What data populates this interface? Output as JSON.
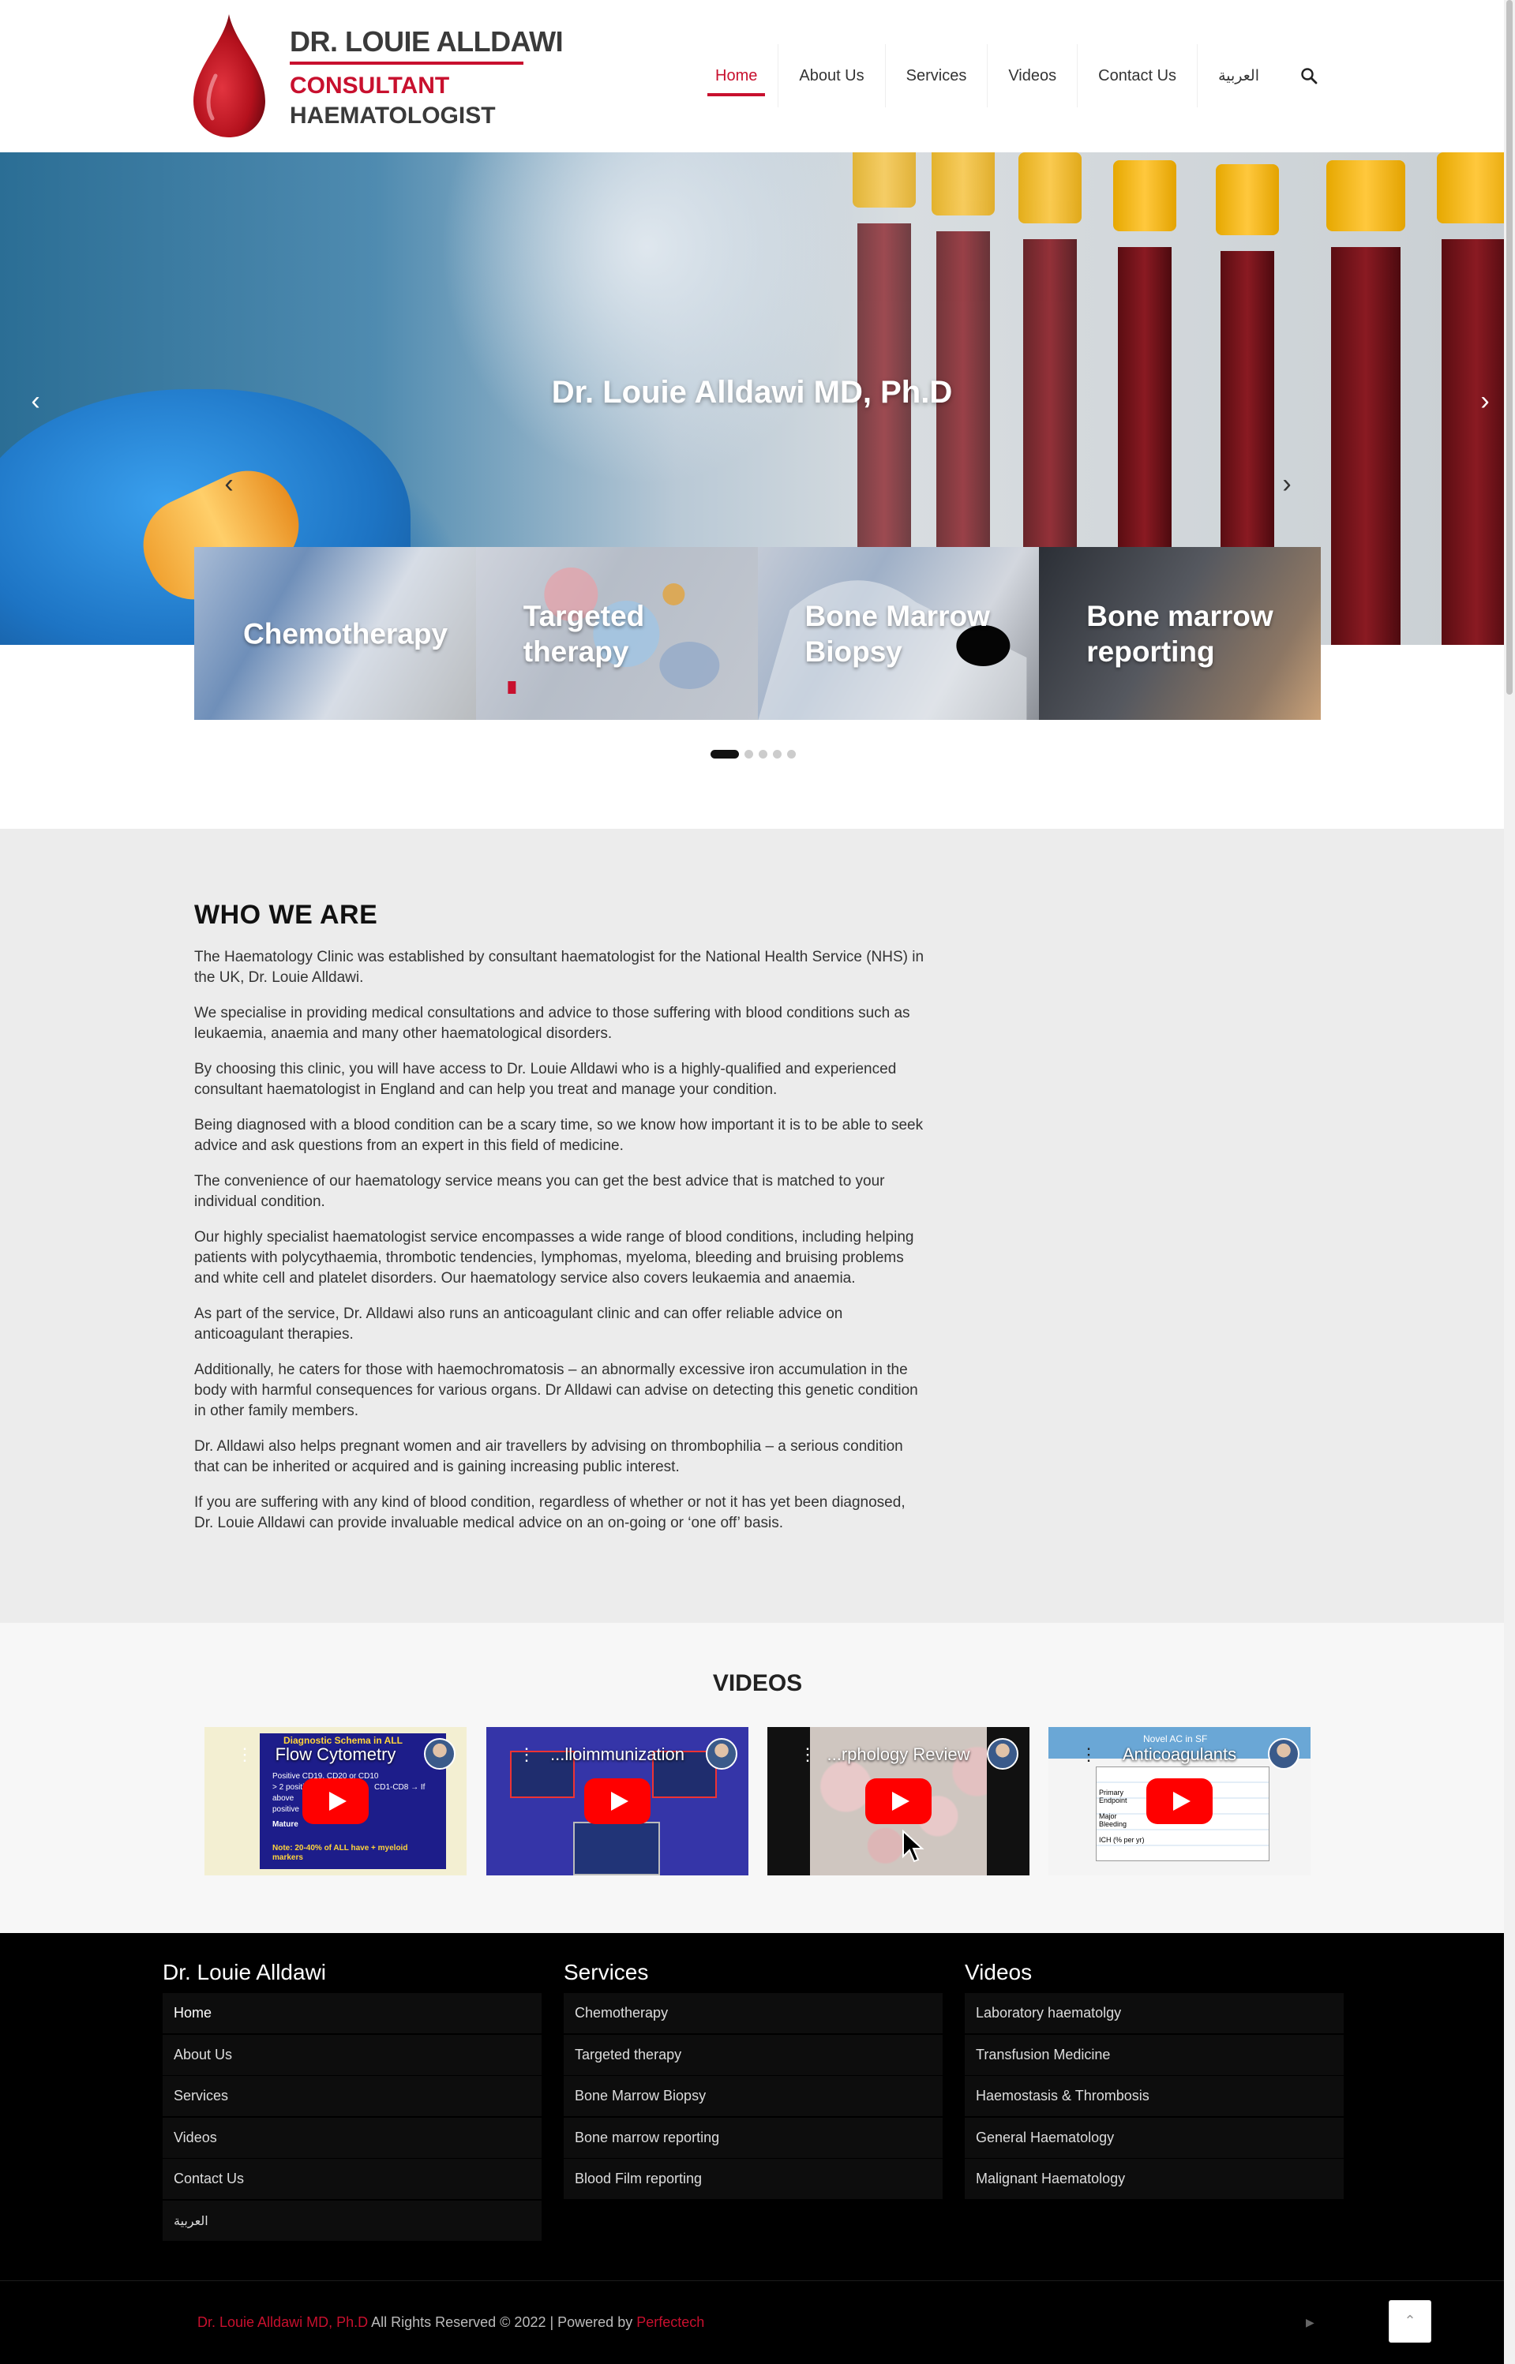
{
  "logo": {
    "name": "DR. LOUIE ALLDAWI",
    "line1": "CONSULTANT",
    "line2": "HAEMATOLOGIST"
  },
  "nav": {
    "items": [
      {
        "label": "Home",
        "active": true
      },
      {
        "label": "About Us"
      },
      {
        "label": "Services"
      },
      {
        "label": "Videos"
      },
      {
        "label": "Contact Us"
      },
      {
        "label": "العربية"
      }
    ],
    "search_icon": "search-icon"
  },
  "hero": {
    "title": "Dr. Louie Alldawi MD, Ph.D",
    "prev_icon": "chevron-left-icon",
    "next_icon": "chevron-right-icon"
  },
  "services_cards": [
    {
      "label": "Chemotherapy"
    },
    {
      "label": "Targeted therapy"
    },
    {
      "label": "Bone Marrow Biopsy"
    },
    {
      "label": "Bone marrow reporting"
    }
  ],
  "carousel_dots": {
    "count": 5,
    "active": 0
  },
  "who": {
    "title": "WHO WE ARE",
    "paragraphs": [
      "The Haematology Clinic was established by consultant haematologist for the National Health Service (NHS) in the UK, Dr. Louie Alldawi.",
      "We specialise in providing medical consultations and advice to those suffering with blood conditions such as leukaemia, anaemia and many other haematological disorders.",
      "By choosing this clinic, you will have access to Dr. Louie Alldawi who is a highly-qualified and experienced consultant haematologist in England and can help you treat and manage your condition.",
      "Being diagnosed with a blood condition can be a scary time, so we know how important it is to be able to seek advice and ask questions from an expert in this field of medicine.",
      "The convenience of our haematology service means you can get the best advice that is matched to your individual condition.",
      "Our highly specialist haematologist service encompasses a wide range of blood conditions, including helping patients with polycythaemia, thrombotic tendencies, lymphomas, myeloma, bleeding and bruising problems and white cell and platelet disorders. Our haematology service also covers leukaemia and anaemia.",
      "As part of the service, Dr. Alldawi also runs an anticoagulant clinic and can offer reliable advice on anticoagulant therapies.",
      "Additionally, he caters for those with haemochromatosis – an abnormally excessive iron accumulation in the body with harmful consequences for various organs. Dr Alldawi can advise on detecting this genetic condition in other family members.",
      "Dr. Alldawi also helps pregnant women and air travellers by advising on thrombophilia – a serious condition that can be inherited or acquired and is gaining increasing public interest.",
      "If you are suffering with any kind of blood condition, regardless of whether or not it has yet been diagnosed, Dr. Louie Alldawi can provide invaluable medical advice on an on-going or ‘one off’ basis."
    ]
  },
  "videos": {
    "title": "VIDEOS",
    "items": [
      {
        "title": "Flow Cytometry"
      },
      {
        "title": "...lloimmunization"
      },
      {
        "title": "...rphology Review"
      },
      {
        "title": "Anticoagulants"
      }
    ],
    "video1_overlay": {
      "heading": "Diagnostic Schema in ALL",
      "lines": [
        "Positive CD19, CD20 or CD10",
        "> 2 positive",
        "CD1-CD8 → If",
        "above",
        "positive",
        "Mature",
        "Note: 20-40% of ALL have + myeloid markers"
      ]
    },
    "video4_overlay": {
      "heading": "Novel AC in SF",
      "rows": [
        "Primary Endpoint",
        "Major Bleeding",
        "ICH (% per yr)"
      ]
    }
  },
  "footer": {
    "columns": [
      {
        "title": "Dr. Louie Alldawi",
        "items": [
          "Home",
          "About Us",
          "Services",
          "Videos",
          "Contact Us",
          "العربية"
        ]
      },
      {
        "title": "Services",
        "items": [
          "Chemotherapy",
          "Targeted therapy",
          "Bone Marrow Biopsy",
          "Bone marrow reporting",
          "Blood Film reporting"
        ]
      },
      {
        "title": "Videos",
        "items": [
          "Laboratory haematolgy",
          "Transfusion Medicine",
          "Haemostasis & Thrombosis",
          "General Haematology",
          "Malignant Haematology"
        ]
      }
    ],
    "copyright_name": "Dr. Louie Alldawi MD, Ph.D",
    "copyright_text": " All Rights Reserved © 2022 | Powered by ",
    "powered_by": "Perfectech"
  },
  "colors": {
    "accent": "#c8102e",
    "footer_bg": "#000000",
    "section_bg": "#ececec"
  }
}
